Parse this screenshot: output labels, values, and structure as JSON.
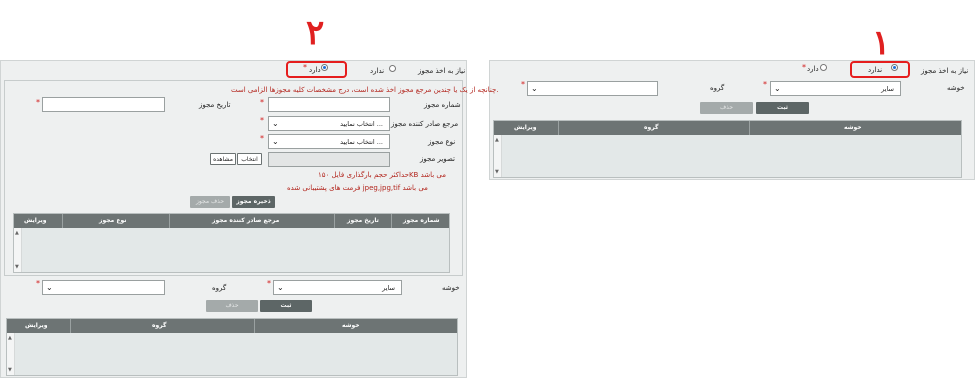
{
  "annotations": {
    "right_number": "١",
    "left_number": "٢"
  },
  "right": {
    "license_question": "نیاز به اخذ مجوز",
    "option_no": "ندارد",
    "option_yes": "دارد",
    "required_mark": "*",
    "cluster_label": "خوشه",
    "cluster_value": "سایر",
    "group_label": "گروه",
    "register_btn": "ثبت",
    "delete_btn": "حذف",
    "grid_headers": [
      "خوشه",
      "گروه",
      "ویرایش"
    ]
  },
  "left": {
    "license_question": "نیاز به اخذ مجوز",
    "option_no": "ندارد",
    "option_yes": "دارد",
    "required_mark": "*",
    "note": "چنانچه از یک یا چندین مرجع مجوز اخذ شده است، درج مشخصات کلیه مجوزها الزامی است.",
    "license_number_label": "شماره مجوز",
    "license_date_label": "تاریخ مجوز",
    "issuer_label": "مرجع صادر کننده مجوز",
    "issuer_value": "انتخاب نمایید ...",
    "license_type_label": "نوع مجوز",
    "license_type_value": "انتخاب نمایید ...",
    "license_image_label": "تصویر مجوز",
    "choose_btn": "انتخاب",
    "view_btn": "مشاهده",
    "max_size_note": "حداکثر حجم بارگذاری فایل ۱۵۰KB می باشد",
    "formats_note": "فرمت های پشتیبانی شده jpeg,jpg,tif می باشد",
    "save_license_btn": "ذخیره مجوز",
    "delete_license_btn": "حذف مجوز",
    "license_grid_headers": [
      "شماره مجوز",
      "تاریخ مجوز",
      "مرجع صادر کننده مجوز",
      "نوع مجوز",
      "ویرایش"
    ],
    "cluster_label": "خوشه",
    "cluster_value": "سایر",
    "group_label": "گروه",
    "register_btn": "ثبت",
    "delete_btn": "حذف",
    "grid_headers": [
      "خوشه",
      "گروه",
      "ویرایش"
    ]
  }
}
